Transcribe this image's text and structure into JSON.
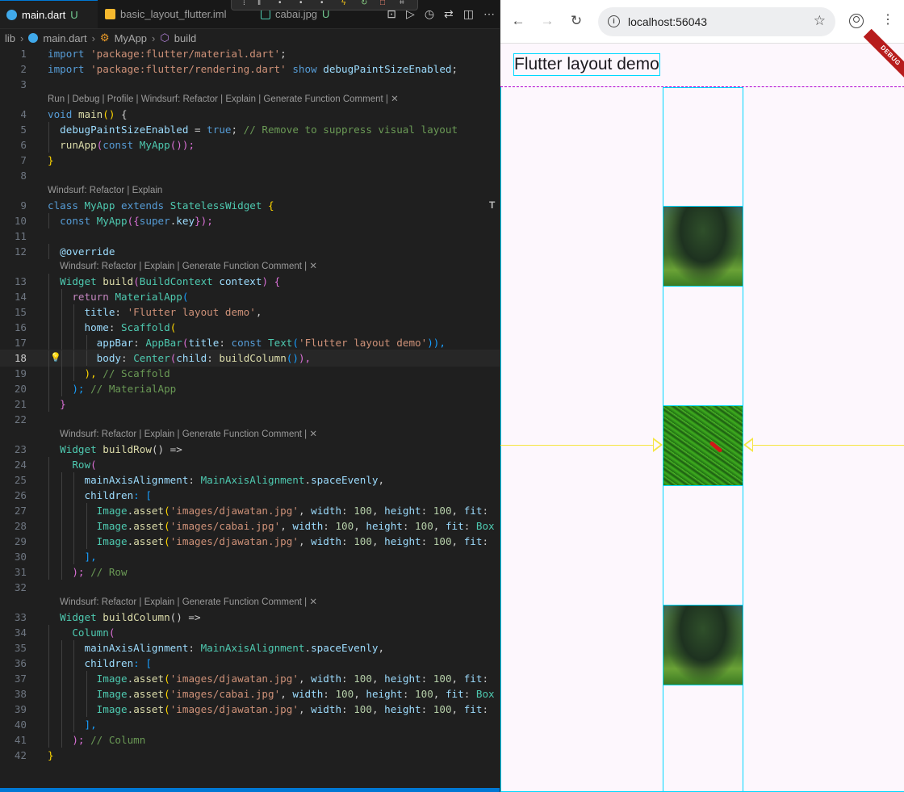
{
  "editor": {
    "tabs": [
      {
        "label": "main.dart",
        "status": "U",
        "active": true
      },
      {
        "label": "basic_layout_flutter.iml",
        "status": "",
        "active": false
      },
      {
        "label": "cabai.jpg",
        "status": "U",
        "active": false
      }
    ],
    "breadcrumb": [
      "lib",
      "main.dart",
      "MyApp",
      "build"
    ],
    "codelens": {
      "main": "Run | Debug | Profile | Windsurf: Refactor | Explain | Generate Function Comment | ✕",
      "myapp": "Windsurf: Refactor | Explain",
      "build": "Windsurf: Refactor | Explain | Generate Function Comment | ✕",
      "buildRow": "Windsurf: Refactor | Explain | Generate Function Comment | ✕",
      "buildColumn": "Windsurf: Refactor | Explain | Generate Function Comment | ✕"
    },
    "lines": {
      "l1": [
        "import",
        " ",
        "'package:flutter/material.dart'",
        ";"
      ],
      "l2": [
        "import",
        " ",
        "'package:flutter/rendering.dart'",
        " ",
        "show",
        " ",
        "debugPaintSizeEnabled",
        ";"
      ],
      "l4": [
        "void",
        " ",
        "main",
        "()",
        " {"
      ],
      "l5": [
        "  ",
        "debugPaintSizeEnabled",
        " = ",
        "true",
        "; ",
        "// Remove to suppress visual layout"
      ],
      "l6": [
        "  ",
        "runApp",
        "(",
        "const",
        " ",
        "MyApp",
        "());"
      ],
      "l7": [
        "}"
      ],
      "l9": [
        "class",
        " ",
        "MyApp",
        " ",
        "extends",
        " ",
        "StatelessWidget",
        " {"
      ],
      "l10": [
        "  ",
        "const",
        " ",
        "MyApp",
        "({",
        "super",
        ".",
        "key",
        "});"
      ],
      "l12": [
        "  ",
        "@override"
      ],
      "l13": [
        "  ",
        "Widget",
        " ",
        "build",
        "(",
        "BuildContext",
        " ",
        "context",
        ") {"
      ],
      "l14": [
        "    ",
        "return",
        " ",
        "MaterialApp",
        "("
      ],
      "l15": [
        "      ",
        "title",
        ": ",
        "'Flutter layout demo'",
        ","
      ],
      "l16": [
        "      ",
        "home",
        ": ",
        "Scaffold",
        "("
      ],
      "l17": [
        "        ",
        "appBar",
        ": ",
        "AppBar",
        "(",
        "title",
        ": ",
        "const",
        " ",
        "Text",
        "(",
        "'Flutter layout demo'",
        ")),"
      ],
      "l18": [
        "        ",
        "body",
        ": ",
        "Center",
        "(",
        "child",
        ": ",
        "buildColumn",
        "()",
        "),"
      ],
      "l19": [
        "      ",
        "), ",
        "// Scaffold"
      ],
      "l20": [
        "    ",
        "); ",
        "// MaterialApp"
      ],
      "l21": [
        "  ",
        "}"
      ],
      "l23": [
        "  ",
        "Widget",
        " ",
        "buildRow",
        "() =>"
      ],
      "l24": [
        "    ",
        "Row",
        "("
      ],
      "l25": [
        "      ",
        "mainAxisAlignment",
        ": ",
        "MainAxisAlignment",
        ".",
        "spaceEvenly",
        ","
      ],
      "l26": [
        "      ",
        "children",
        ": ["
      ],
      "l27": [
        "        ",
        "Image",
        ".",
        "asset",
        "(",
        "'images/djawatan.jpg'",
        ", ",
        "width",
        ": ",
        "100",
        ", ",
        "height",
        ": ",
        "100",
        ", ",
        "fit",
        ":"
      ],
      "l28": [
        "        ",
        "Image",
        ".",
        "asset",
        "(",
        "'images/cabai.jpg'",
        ", ",
        "width",
        ": ",
        "100",
        ", ",
        "height",
        ": ",
        "100",
        ", ",
        "fit",
        ": ",
        "Box"
      ],
      "l29": [
        "        ",
        "Image",
        ".",
        "asset",
        "(",
        "'images/djawatan.jpg'",
        ", ",
        "width",
        ": ",
        "100",
        ", ",
        "height",
        ": ",
        "100",
        ", ",
        "fit",
        ":"
      ],
      "l30": [
        "      ",
        "],"
      ],
      "l31": [
        "    ",
        "); ",
        "// Row"
      ],
      "l33": [
        "  ",
        "Widget",
        " ",
        "buildColumn",
        "() =>"
      ],
      "l34": [
        "    ",
        "Column",
        "("
      ],
      "l35": [
        "      ",
        "mainAxisAlignment",
        ": ",
        "MainAxisAlignment",
        ".",
        "spaceEvenly",
        ","
      ],
      "l36": [
        "      ",
        "children",
        ": ["
      ],
      "l37": [
        "        ",
        "Image",
        ".",
        "asset",
        "(",
        "'images/djawatan.jpg'",
        ", ",
        "width",
        ": ",
        "100",
        ", ",
        "height",
        ": ",
        "100",
        ", ",
        "fit",
        ":"
      ],
      "l38": [
        "        ",
        "Image",
        ".",
        "asset",
        "(",
        "'images/cabai.jpg'",
        ", ",
        "width",
        ": ",
        "100",
        ", ",
        "height",
        ": ",
        "100",
        ", ",
        "fit",
        ": ",
        "Box"
      ],
      "l39": [
        "        ",
        "Image",
        ".",
        "asset",
        "(",
        "'images/djawatan.jpg'",
        ", ",
        "width",
        ": ",
        "100",
        ", ",
        "height",
        ": ",
        "100",
        ", ",
        "fit",
        ":"
      ],
      "l40": [
        "      ",
        "],"
      ],
      "l41": [
        "    ",
        "); ",
        "// Column"
      ],
      "l42": [
        "}"
      ]
    },
    "line_numbers": [
      "1",
      "2",
      "3",
      "4",
      "5",
      "6",
      "7",
      "8",
      "9",
      "10",
      "11",
      "12",
      "13",
      "14",
      "15",
      "16",
      "17",
      "18",
      "19",
      "20",
      "21",
      "22",
      "23",
      "24",
      "25",
      "26",
      "27",
      "28",
      "29",
      "30",
      "31",
      "32",
      "33",
      "34",
      "35",
      "36",
      "37",
      "38",
      "39",
      "40",
      "41",
      "42"
    ],
    "current_line": "18"
  },
  "browser": {
    "url": "localhost:56043",
    "app_title": "Flutter layout demo",
    "debug_label": "DEBUG",
    "images": [
      {
        "name": "djawatan.jpg",
        "kind": "forest"
      },
      {
        "name": "cabai.jpg",
        "kind": "chili"
      },
      {
        "name": "djawatan.jpg",
        "kind": "forest"
      }
    ]
  },
  "colors": {
    "editor_bg": "#1f1f1f",
    "accent": "#0078d4",
    "debug_outline": "#00d8ff",
    "baseline": "#f5e642",
    "debug_banner": "#b71c1c"
  }
}
